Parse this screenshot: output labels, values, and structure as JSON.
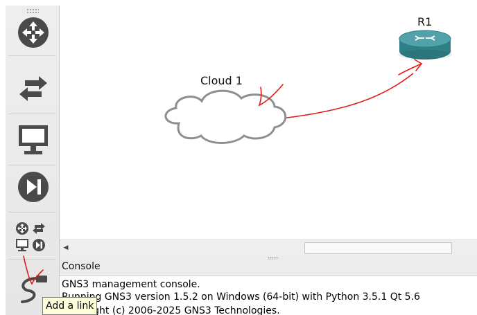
{
  "canvas": {
    "nodes": [
      {
        "label": "Cloud 1",
        "icon": "cloud-icon"
      },
      {
        "label": "R1",
        "icon": "router-icon"
      }
    ]
  },
  "toolbar": {
    "items": [
      {
        "name": "routers-category",
        "icon": "router-move-icon"
      },
      {
        "name": "switches-category",
        "icon": "switch-arrows-icon"
      },
      {
        "name": "end-devices-category",
        "icon": "monitor-icon"
      },
      {
        "name": "security-devices-category",
        "icon": "play-next-icon"
      },
      {
        "name": "all-devices-category",
        "icon": "all-devices-icon"
      },
      {
        "name": "add-link-button",
        "icon": "cable-icon"
      }
    ]
  },
  "console": {
    "title": "Console",
    "lines": [
      "GNS3 management console.",
      "Running GNS3 version 1.5.2 on Windows (64-bit) with Python 3.5.1 Qt 5.6",
      "Copyright (c) 2006-2025 GNS3 Technologies."
    ]
  },
  "tooltip": {
    "text": "Add a link"
  },
  "colors": {
    "device_icon": "#4a4a4a",
    "router_body": "#3b8f95",
    "annotation_red": "#e01b1b"
  }
}
